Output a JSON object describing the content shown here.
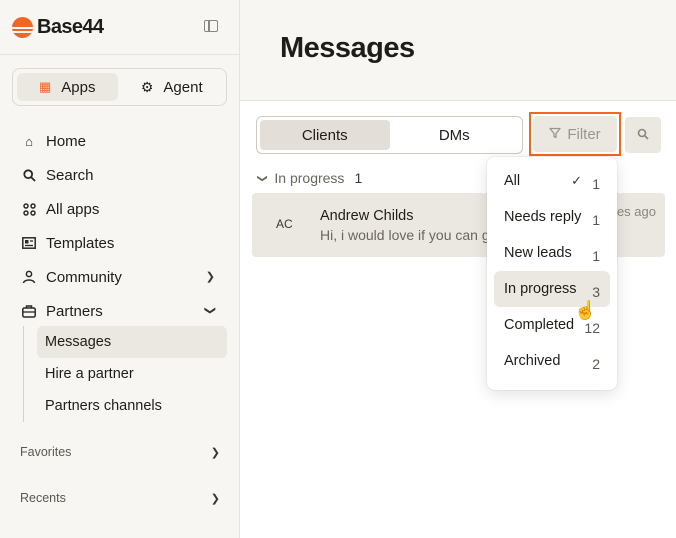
{
  "brand": {
    "name": "Base44"
  },
  "mode_switch": {
    "apps_label": "Apps",
    "agent_label": "Agent"
  },
  "nav": {
    "items": [
      {
        "label": "Home",
        "icon": "home-icon"
      },
      {
        "label": "Search",
        "icon": "search-icon"
      },
      {
        "label": "All apps",
        "icon": "grid-icon"
      },
      {
        "label": "Templates",
        "icon": "templates-icon"
      },
      {
        "label": "Community",
        "icon": "community-icon"
      },
      {
        "label": "Partners",
        "icon": "briefcase-icon"
      }
    ],
    "partners_sub": [
      {
        "label": "Messages"
      },
      {
        "label": "Hire a partner"
      },
      {
        "label": "Partners channels"
      }
    ],
    "favorites_label": "Favorites",
    "recents_label": "Recents"
  },
  "main": {
    "title": "Messages",
    "tabs": [
      {
        "label": "Clients"
      },
      {
        "label": "DMs"
      }
    ],
    "filter_label": "Filter",
    "group": {
      "label": "In progress",
      "count": "1"
    },
    "rows": [
      {
        "initials": "AC",
        "name": "Andrew Childs",
        "preview": "Hi, i would love if you can g",
        "time": "tes ago"
      }
    ]
  },
  "filter_menu": {
    "options": [
      {
        "label": "All",
        "count": "1",
        "selected": true
      },
      {
        "label": "Needs reply",
        "count": "1"
      },
      {
        "label": "New leads",
        "count": "1"
      },
      {
        "label": "In progress",
        "count": "3",
        "hovered": true
      },
      {
        "label": "Completed",
        "count": "12"
      },
      {
        "label": "Archived",
        "count": "2"
      }
    ]
  },
  "colors": {
    "accent": "#f26522",
    "selected_bg": "#ebe8e2"
  }
}
